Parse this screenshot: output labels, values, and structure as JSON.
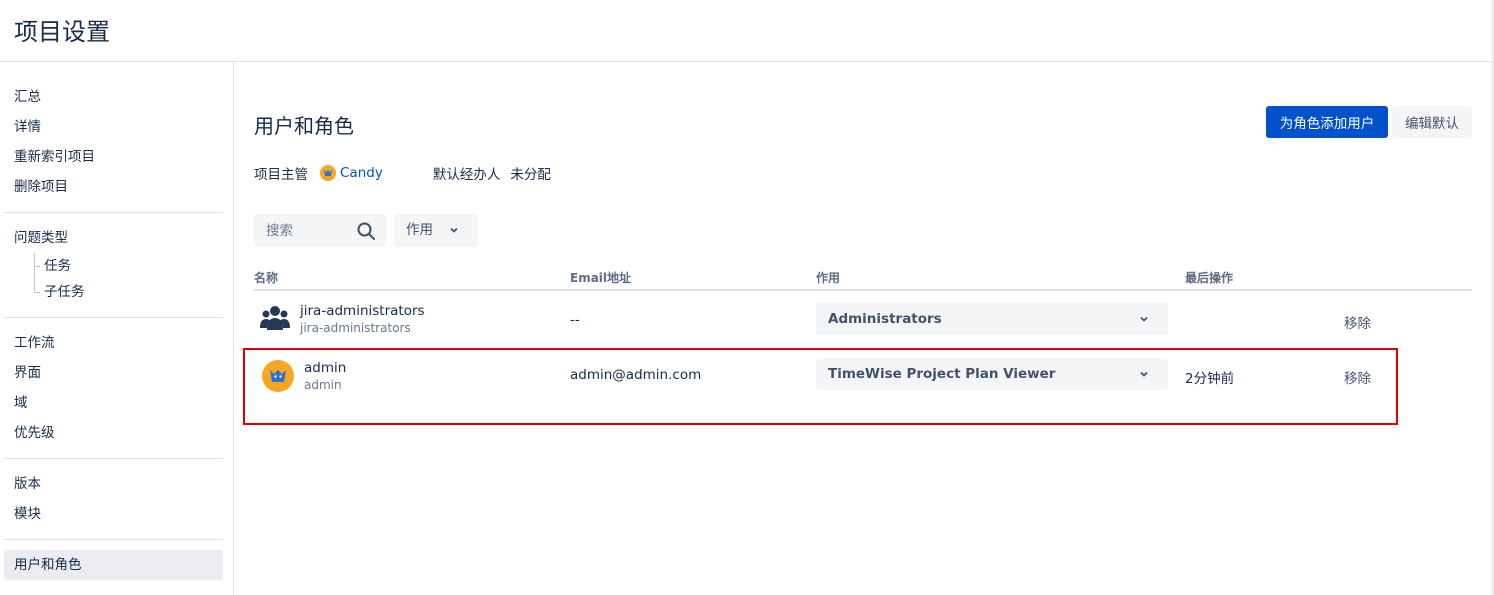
{
  "page": {
    "title": "项目设置"
  },
  "sidebar": {
    "groups": [
      {
        "items": [
          "汇总",
          "详情",
          "重新索引项目",
          "删除项目"
        ]
      },
      {
        "heading": "问题类型",
        "children": [
          "任务",
          "子任务"
        ]
      },
      {
        "items": [
          "工作流",
          "界面",
          "域",
          "优先级"
        ]
      },
      {
        "items": [
          "版本",
          "模块"
        ]
      },
      {
        "items": [
          "用户和角色"
        ],
        "active": "用户和角色"
      }
    ]
  },
  "main": {
    "title": "用户和角色",
    "add_users_button": "为角色添加用户",
    "edit_defaults_button": "编辑默认",
    "project_lead_label": "项目主管",
    "project_lead": "Candy",
    "default_assignee_label": "默认经办人",
    "default_assignee": "未分配",
    "search_placeholder": "搜索",
    "role_filter_label": "作用",
    "columns": {
      "name": "名称",
      "email": "Email地址",
      "role": "作用",
      "last_action": "最后操作"
    },
    "rows": [
      {
        "type": "group",
        "name": "jira-administrators",
        "sub": "jira-administrators",
        "email": "--",
        "role": "Administrators",
        "last_action": "",
        "remove": "移除"
      },
      {
        "type": "user",
        "name": "admin",
        "sub": "admin",
        "email": "admin@admin.com",
        "role": "TimeWise Project Plan Viewer",
        "last_action": "2分钟前",
        "remove": "移除"
      }
    ]
  },
  "colors": {
    "primary": "#0052cc",
    "highlight": "#e00000",
    "avatar": "#f5a623"
  }
}
